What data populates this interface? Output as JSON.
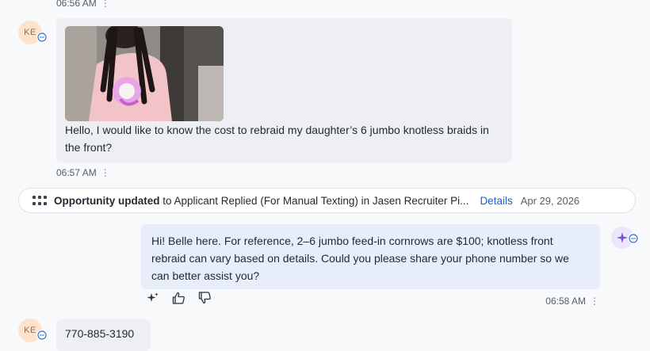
{
  "messages": [
    {
      "time": "06:56 AM",
      "menu": "⋮"
    },
    {
      "avatar": "KE",
      "image_alt": "Photo of a child with braids wearing a pink unicorn t-shirt",
      "text": "Hello, I would like to know the cost to rebraid my daughter’s 6 jumbo knotless braids in the front?",
      "time": "06:57 AM",
      "menu": "⋮"
    }
  ],
  "event": {
    "bold": "Opportunity updated",
    "text": " to Applicant Replied (For Manual Texting) in Jasen Recruiter Pi...",
    "link": "Details",
    "date": "Apr 29, 2026"
  },
  "reply": {
    "text": "Hi! Belle here. For reference, 2–6 jumbo feed-in cornrows are $100; knotless front rebraid can vary based on details. Could you please share your phone number so we can better assist you?",
    "time": "06:58 AM",
    "menu": "⋮"
  },
  "last_message": {
    "avatar": "KE",
    "text": "770-885-3190"
  },
  "colors": {
    "accent": "#1a5fd0",
    "ai": "#7b4fd6",
    "bubble_out": "#e8eef9",
    "bubble_in": "#eeeff2"
  }
}
